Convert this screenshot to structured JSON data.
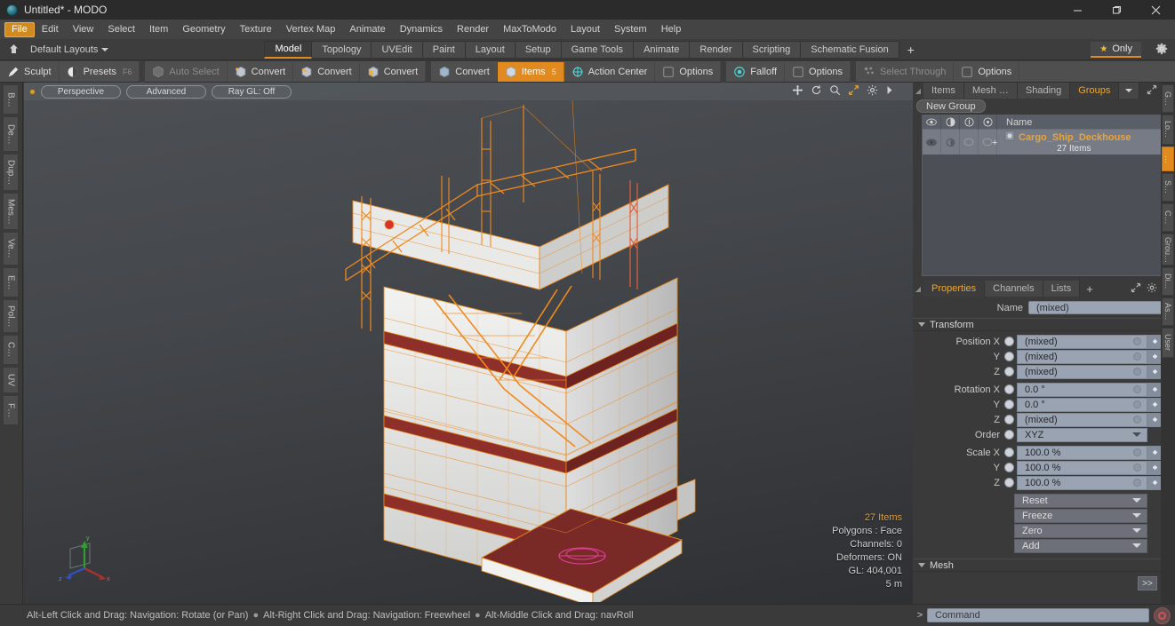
{
  "window": {
    "title": "Untitled* - MODO",
    "logo_icon": "modo-logo-icon",
    "minimize_label": "─",
    "maximize_label": "❐",
    "close_label": "✕"
  },
  "menubar": {
    "items": [
      {
        "label": "File",
        "active": true
      },
      {
        "label": "Edit",
        "active": false
      },
      {
        "label": "View",
        "active": false
      },
      {
        "label": "Select",
        "active": false
      },
      {
        "label": "Item",
        "active": false
      },
      {
        "label": "Geometry",
        "active": false
      },
      {
        "label": "Texture",
        "active": false
      },
      {
        "label": "Vertex Map",
        "active": false
      },
      {
        "label": "Animate",
        "active": false
      },
      {
        "label": "Dynamics",
        "active": false
      },
      {
        "label": "Render",
        "active": false
      },
      {
        "label": "MaxToModo",
        "active": false
      },
      {
        "label": "Layout",
        "active": false
      },
      {
        "label": "System",
        "active": false
      },
      {
        "label": "Help",
        "active": false
      }
    ]
  },
  "layoutbar": {
    "home_icon": "home-layout-icon",
    "default_layouts_label": "Default Layouts",
    "tabs": [
      {
        "label": "Model",
        "active": true
      },
      {
        "label": "Topology",
        "active": false
      },
      {
        "label": "UVEdit",
        "active": false
      },
      {
        "label": "Paint",
        "active": false
      },
      {
        "label": "Layout",
        "active": false
      },
      {
        "label": "Setup",
        "active": false
      },
      {
        "label": "Game Tools",
        "active": false
      },
      {
        "label": "Animate",
        "active": false
      },
      {
        "label": "Render",
        "active": false
      },
      {
        "label": "Scripting",
        "active": false
      },
      {
        "label": "Schematic Fusion",
        "active": false
      }
    ],
    "add_tab_label": "+",
    "only_label": "Only",
    "only_star_icon": "star-icon",
    "settings_icon": "gear-icon"
  },
  "toolrow": {
    "buttons": [
      {
        "label": "Sculpt",
        "icon": "brush-icon",
        "state": "normal",
        "hotkey": ""
      },
      {
        "label": "Presets",
        "icon": "sphere-icon",
        "state": "normal",
        "hotkey": "F6"
      },
      {
        "label": "Auto Select",
        "icon": "cube-gray-icon",
        "state": "dim",
        "hotkey": ""
      },
      {
        "label": "Convert",
        "icon": "cube-vertex-icon",
        "state": "normal",
        "hotkey": ""
      },
      {
        "label": "Convert",
        "icon": "cube-edge-icon",
        "state": "normal",
        "hotkey": ""
      },
      {
        "label": "Convert",
        "icon": "cube-poly-icon",
        "state": "normal",
        "hotkey": ""
      },
      {
        "label": "Convert",
        "icon": "cube-mat-icon",
        "state": "normal",
        "hotkey": ""
      },
      {
        "label": "Items",
        "icon": "items-icon",
        "state": "selected",
        "hotkey": "5"
      },
      {
        "label": "Action Center",
        "icon": "action-center-icon",
        "state": "normal",
        "hotkey": ""
      },
      {
        "label": "Options",
        "icon": "options-box-icon",
        "state": "normal",
        "hotkey": ""
      },
      {
        "label": "Falloff",
        "icon": "falloff-icon",
        "state": "normal",
        "hotkey": ""
      },
      {
        "label": "Options",
        "icon": "options-box-icon",
        "state": "normal",
        "hotkey": ""
      },
      {
        "label": "Select Through",
        "icon": "select-through-icon",
        "state": "dim",
        "hotkey": ""
      },
      {
        "label": "Options",
        "icon": "options-box-icon",
        "state": "normal",
        "hotkey": ""
      }
    ]
  },
  "left_strip": {
    "tabs": [
      {
        "label": "B…"
      },
      {
        "label": "De…"
      },
      {
        "label": "Dup…"
      },
      {
        "label": "Mes…"
      },
      {
        "label": "Ve…"
      },
      {
        "label": "E…"
      },
      {
        "label": "Pol…"
      },
      {
        "label": "C…"
      },
      {
        "label": "UV"
      },
      {
        "label": "F…"
      }
    ]
  },
  "viewport": {
    "indicator_icon": "viewport-active-dot",
    "view_mode": "Perspective",
    "shading_mode": "Advanced",
    "raygl_mode": "Ray GL: Off",
    "header_icons": [
      "pan-icon",
      "rotate-icon",
      "zoom-icon",
      "fit-icon",
      "gear-icon",
      "more-arrow-icon"
    ],
    "stats": {
      "items": "27 Items",
      "polygons": "Polygons : Face",
      "channels": "Channels: 0",
      "deformers": "Deformers: ON",
      "gl": "GL: 404,001",
      "scale": "5 m"
    },
    "axis_gizmo": {
      "x_label": "x",
      "y_label": "y",
      "z_label": "z",
      "x_color": "#a03030",
      "y_color": "#30a030",
      "z_color": "#3050c0"
    },
    "model_name": "Cargo Ship Deckhouse",
    "wire_color": "#f08a1e",
    "surface_color": "#e8e8e8"
  },
  "statusbar": {
    "hints": [
      "Alt-Left Click and Drag: Navigation: Rotate (or Pan)",
      "Alt-Right Click and Drag: Navigation: Freewheel",
      "Alt-Middle Click and Drag: navRoll"
    ],
    "separator": "●"
  },
  "groups_panel": {
    "tabs": [
      {
        "label": "Items",
        "active": false
      },
      {
        "label": "Mesh …",
        "active": false
      },
      {
        "label": "Shading",
        "active": false
      },
      {
        "label": "Groups",
        "active": true
      }
    ],
    "overflow_icon": "chevron-down-icon",
    "expand_icon": "expand-arrows-icon",
    "more_icon": "more-arrow-icon",
    "new_group_label": "New Group",
    "columns": {
      "visibility_icon": "eye-icon",
      "render_icon": "render-icon",
      "lock_icon": "lock-icon",
      "info_icon": "info-icon",
      "name_header": "Name"
    },
    "rows": [
      {
        "name": "Cargo_Ship_Deckhouse",
        "subtitle": "27 Items",
        "item_icon": "group-item-icon",
        "expand_glyph": "+",
        "selected": true
      }
    ]
  },
  "properties_panel": {
    "tabs": [
      {
        "label": "Properties",
        "active": true
      },
      {
        "label": "Channels",
        "active": false
      },
      {
        "label": "Lists",
        "active": false
      }
    ],
    "add_tab_label": "+",
    "expand_icon": "expand-arrows-icon",
    "settings_icon": "gear-icon",
    "more_icon": "more-arrow-icon",
    "name_label": "Name",
    "name_value": "(mixed)",
    "sections": [
      {
        "id": "transform",
        "label": "Transform",
        "expanded": true
      },
      {
        "id": "mesh",
        "label": "Mesh",
        "expanded": true
      }
    ],
    "transform": {
      "position": {
        "label": "Position X",
        "rows": [
          {
            "axis": "Position X",
            "value": "(mixed)"
          },
          {
            "axis": "Y",
            "value": "(mixed)"
          },
          {
            "axis": "Z",
            "value": "(mixed)"
          }
        ]
      },
      "rotation": {
        "rows": [
          {
            "axis": "Rotation X",
            "value": "0.0 °"
          },
          {
            "axis": "Y",
            "value": "0.0 °"
          },
          {
            "axis": "Z",
            "value": "(mixed)"
          }
        ]
      },
      "order": {
        "label": "Order",
        "value": "XYZ"
      },
      "scale": {
        "rows": [
          {
            "axis": "Scale X",
            "value": "100.0 %"
          },
          {
            "axis": "Y",
            "value": "100.0 %"
          },
          {
            "axis": "Z",
            "value": "100.0 %"
          }
        ]
      },
      "actions": [
        {
          "label": "Reset"
        },
        {
          "label": "Freeze"
        },
        {
          "label": "Zero"
        },
        {
          "label": "Add"
        }
      ]
    },
    "chevron_button_label": ">>"
  },
  "right_strip": {
    "tabs": [
      {
        "label": "G…",
        "active": false
      },
      {
        "label": "Lo…",
        "active": false
      },
      {
        "label": "…",
        "active": true
      },
      {
        "label": "S…",
        "active": false
      },
      {
        "label": "C…",
        "active": false
      },
      {
        "label": "Grou…",
        "active": false
      },
      {
        "label": "Di…",
        "active": false
      },
      {
        "label": "As…",
        "active": false
      },
      {
        "label": "User",
        "active": false
      }
    ]
  },
  "command_bar": {
    "prompt": ">",
    "placeholder": "Command",
    "record_icon": "record-icon"
  },
  "colors": {
    "accent": "#e08a20",
    "wireframe": "#f08a1e",
    "panel_bg": "#3a3a3a",
    "field_bg": "#99a3b1",
    "tree_row": "#767b85"
  }
}
